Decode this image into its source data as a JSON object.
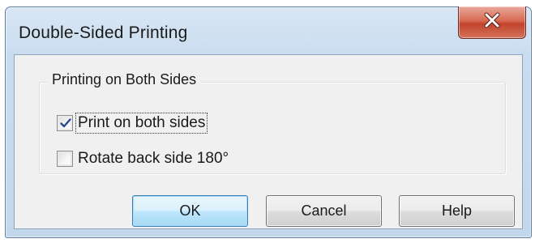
{
  "window": {
    "title": "Double-Sided Printing"
  },
  "titlebar": {
    "close_icon": "close-x-icon"
  },
  "group": {
    "label": "Printing on Both Sides"
  },
  "options": [
    {
      "label": "Print on both sides",
      "checked": true
    },
    {
      "label": "Rotate back side 180°",
      "checked": false
    }
  ],
  "buttons": {
    "ok": "OK",
    "cancel": "Cancel",
    "help": "Help"
  },
  "colors": {
    "close_button": "#c2432b",
    "default_button_border": "#3c7fb1",
    "title_bar": "#c9dcef"
  }
}
